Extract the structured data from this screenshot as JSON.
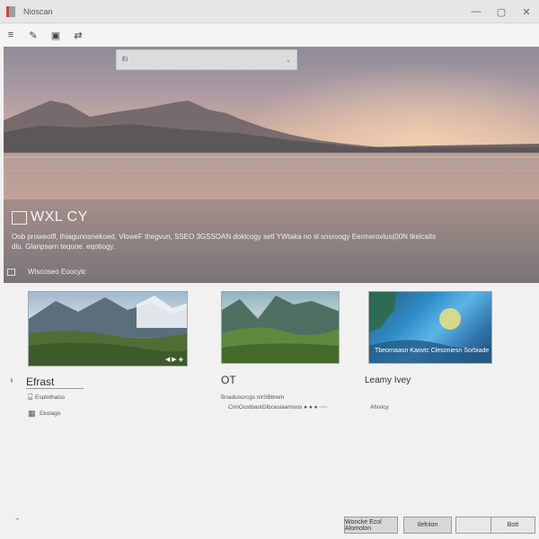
{
  "window": {
    "title": "Nioscan",
    "controls": [
      {
        "name": "minimize",
        "glyph": "—"
      },
      {
        "name": "maximize",
        "glyph": "▢"
      },
      {
        "name": "close",
        "glyph": "✕"
      }
    ]
  },
  "toolbar": {
    "buttons": [
      {
        "name": "menu-icon",
        "glyph": "≡"
      },
      {
        "name": "edit-icon",
        "glyph": "✎"
      },
      {
        "name": "save-icon",
        "glyph": "▣"
      },
      {
        "name": "layout-icon",
        "glyph": "⇄"
      }
    ]
  },
  "hero": {
    "search_value": "Ei",
    "title": "WXL CY",
    "description": "Oob proweolfl, thiagunosnekoed, VloweF thegvun, SSEO 3GSSOAN doklcogy setl YWtaka no sl snsroogy Eermerovlus(00N tkelcalts dlu. Glanpsarn tequoe. eqotiogy.",
    "link_label": "Wlscoseo Eoocylc"
  },
  "cards": [
    {
      "title": "Efrast",
      "subtitle": "Esplothaiss",
      "extra": "Ekolago",
      "thumb_caption": "◀ ▶ ◈"
    },
    {
      "title": "OT",
      "subtitle": "Bnadusorcgs nirSBbrem",
      "extra": "CnnOoxlbastGlbcesiaamoos ● ● ● ◦◦◦◦",
      "thumb_caption": ""
    },
    {
      "title": "Leamy Ivey",
      "subtitle": "",
      "extra": "Afsvicy",
      "thumb_caption": "Tbeornaasn Kaovtc Clesoniesn Sorbiade"
    }
  ],
  "footer": {
    "btn_primary": "Woncke Ecol Alomolon",
    "btn_secondary": "Ilefnlon",
    "btn_empty": "",
    "btn_next": "Bott"
  }
}
